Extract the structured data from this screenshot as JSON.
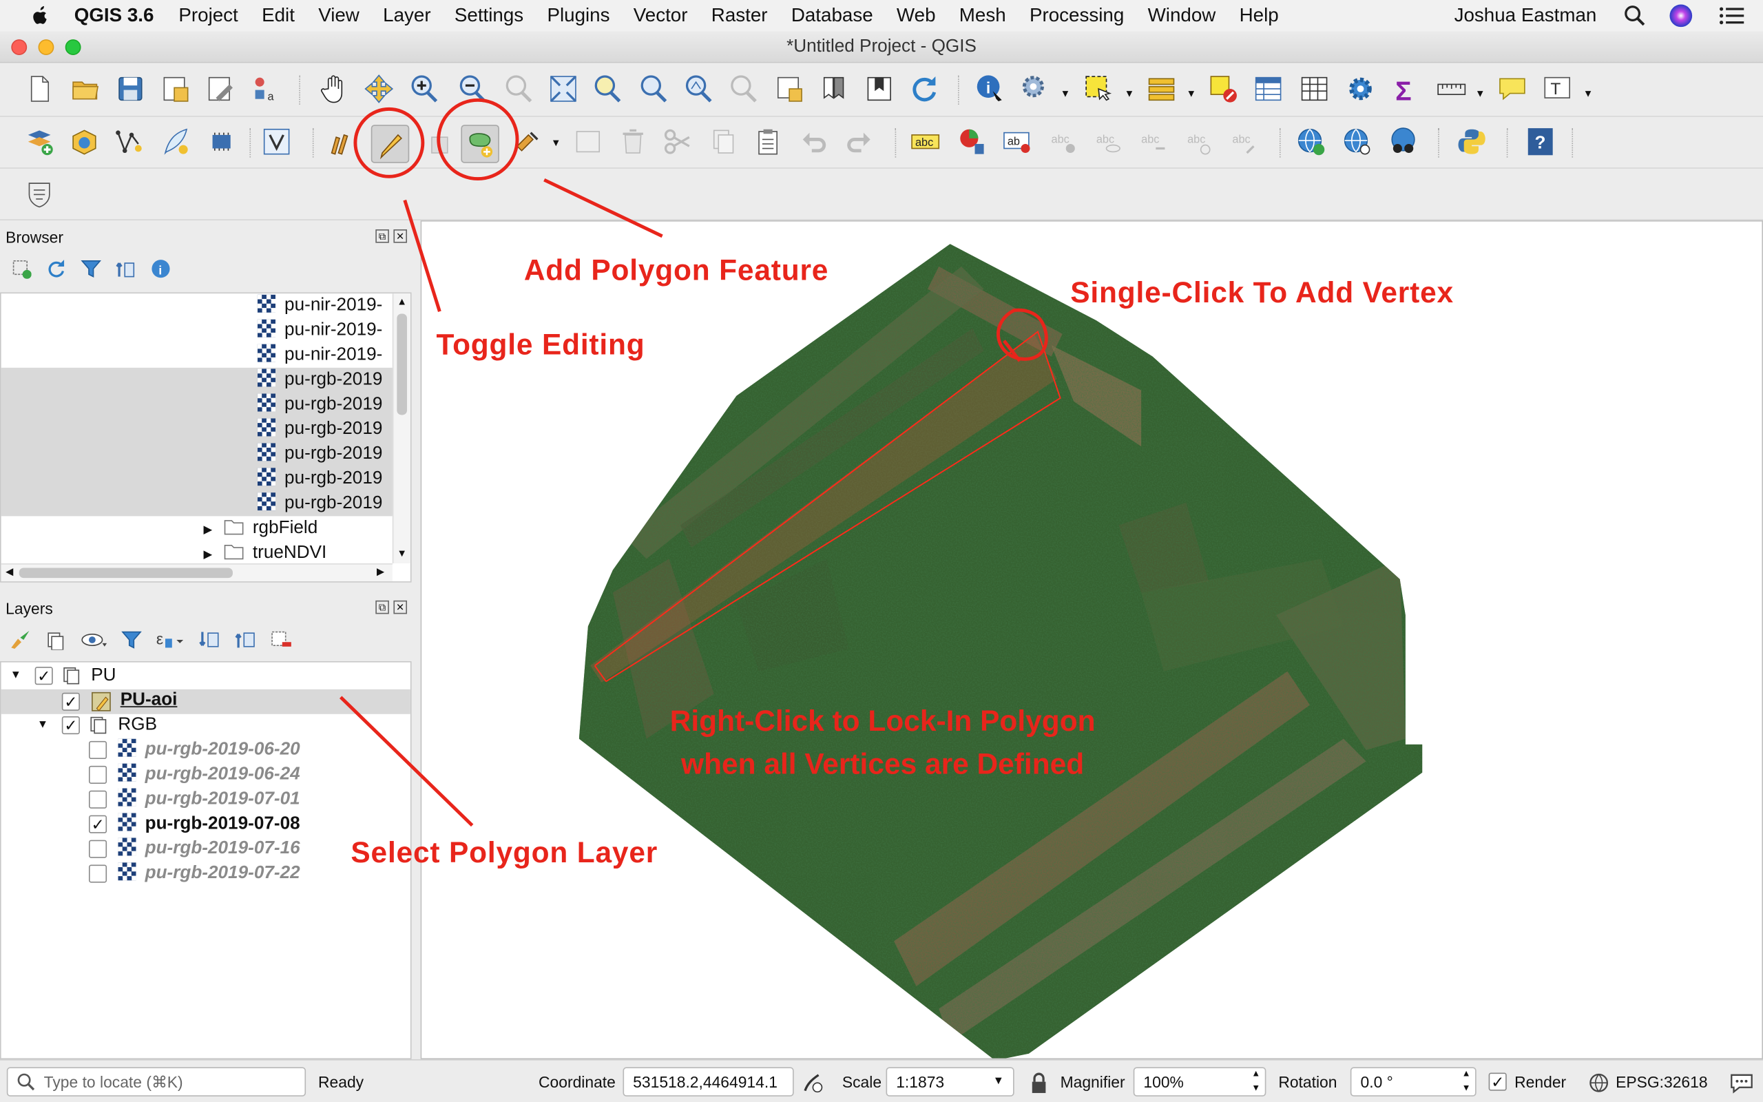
{
  "menubar": {
    "app_name": "QGIS 3.6",
    "items": [
      "Project",
      "Edit",
      "View",
      "Layer",
      "Settings",
      "Plugins",
      "Vector",
      "Raster",
      "Database",
      "Web",
      "Mesh",
      "Processing",
      "Window",
      "Help"
    ],
    "user": "Joshua Eastman"
  },
  "window": {
    "title": "*Untitled Project - QGIS"
  },
  "browser": {
    "title": "Browser",
    "items": [
      "pu-nir-2019-",
      "pu-nir-2019-",
      "pu-nir-2019-",
      "pu-rgb-2019",
      "pu-rgb-2019",
      "pu-rgb-2019",
      "pu-rgb-2019",
      "pu-rgb-2019",
      "pu-rgb-2019"
    ],
    "folders": [
      "rgbField",
      "trueNDVI"
    ]
  },
  "layers": {
    "title": "Layers",
    "group_pu": "PU",
    "pu_aoi": "PU-aoi",
    "group_rgb": "RGB",
    "rasters": [
      "pu-rgb-2019-06-20",
      "pu-rgb-2019-06-24",
      "pu-rgb-2019-07-01",
      "pu-rgb-2019-07-08",
      "pu-rgb-2019-07-16",
      "pu-rgb-2019-07-22"
    ],
    "checked": [
      false,
      false,
      false,
      true,
      false,
      false
    ]
  },
  "annotations": {
    "add_polygon": "Add Polygon Feature",
    "single_click": "Single-Click To Add Vertex",
    "toggle_editing": "Toggle Editing",
    "right_click_1": "Right-Click to Lock-In Polygon",
    "right_click_2": "when all Vertices are Defined",
    "select_layer": "Select Polygon Layer",
    "color": "#e8251b"
  },
  "status": {
    "locate_placeholder": "Type to locate (⌘K)",
    "ready": "Ready",
    "coordinate_label": "Coordinate",
    "coordinate": "531518.2,4464914.1",
    "scale_label": "Scale",
    "scale": "1:1873",
    "magnifier_label": "Magnifier",
    "magnifier": "100%",
    "rotation_label": "Rotation",
    "rotation": "0.0 °",
    "render_label": "Render",
    "crs": "EPSG:32618"
  },
  "icons": [
    "apple-icon",
    "search-icon",
    "siri-icon",
    "notification-icon",
    "new-project-icon",
    "open-project-icon",
    "save-project-icon",
    "pan-icon",
    "zoom-in-icon",
    "zoom-out-icon",
    "refresh-icon",
    "identify-icon",
    "select-icon",
    "pencil-icon",
    "add-polygon-icon",
    "python-icon",
    "help-icon"
  ]
}
